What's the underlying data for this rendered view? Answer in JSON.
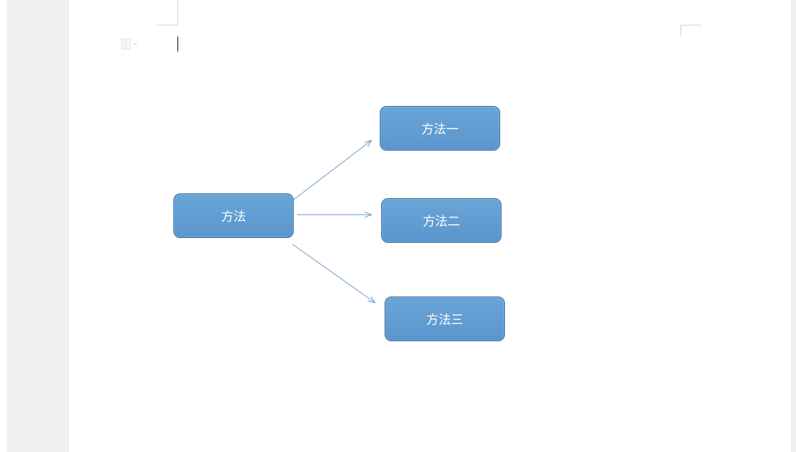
{
  "diagram": {
    "root": {
      "label": "方法"
    },
    "children": [
      {
        "label": "方法一"
      },
      {
        "label": "方法二"
      },
      {
        "label": "方法三"
      }
    ]
  }
}
